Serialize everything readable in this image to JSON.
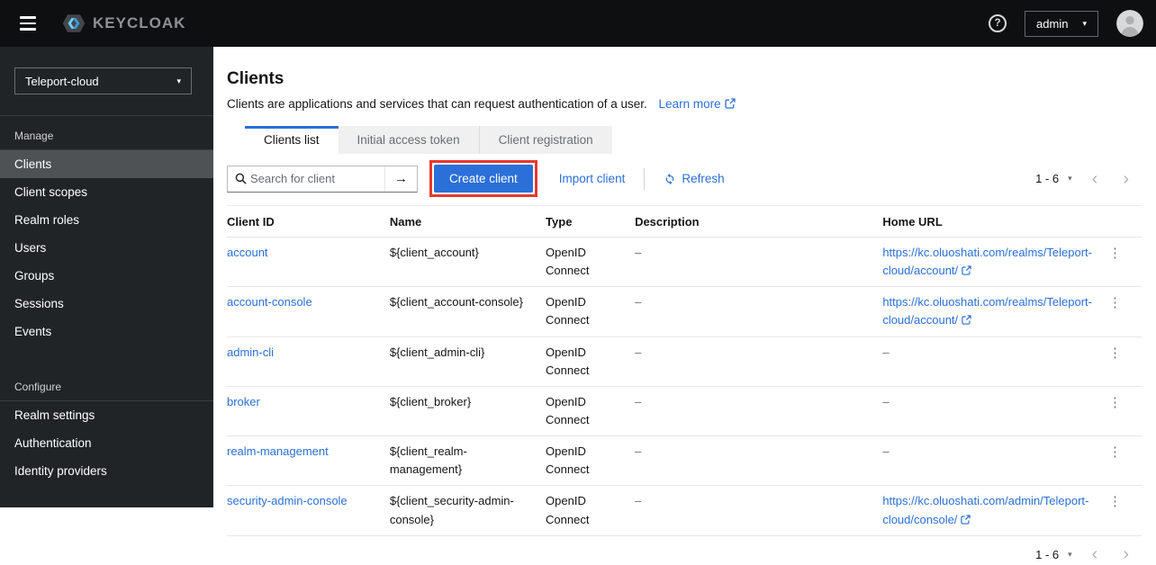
{
  "colors": {
    "accent": "#2b6fd8",
    "annotation_red": "#e8382d",
    "topbar_bg": "#0e0f11",
    "sidebar_bg": "#212427",
    "nav_active_bg": "#4f5255"
  },
  "icons": {
    "caret": "▾",
    "kebab": "⋮",
    "search_submit": "→",
    "help_glyph": "?",
    "prev": "‹",
    "next": "›"
  },
  "topbar": {
    "brand": "KEYCLOAK",
    "user": "admin"
  },
  "sidebar": {
    "realm": "Teleport-cloud",
    "active_item": "Clients",
    "sections": [
      {
        "label": "Manage",
        "items": [
          "Clients",
          "Client scopes",
          "Realm roles",
          "Users",
          "Groups",
          "Sessions",
          "Events"
        ]
      },
      {
        "label": "Configure",
        "items": [
          "Realm settings",
          "Authentication",
          "Identity providers"
        ]
      }
    ]
  },
  "page": {
    "title": "Clients",
    "description": "Clients are applications and services that can request authentication of a user.",
    "learn_more": "Learn more",
    "tabs": [
      "Clients list",
      "Initial access token",
      "Client registration"
    ],
    "active_tab": "Clients list",
    "toolbar": {
      "search_placeholder": "Search for client",
      "create": "Create client",
      "import": "Import client",
      "refresh": "Refresh"
    },
    "pagination": {
      "range": "1 - 6"
    },
    "table": {
      "columns": [
        "Client ID",
        "Name",
        "Type",
        "Description",
        "Home URL"
      ],
      "rows": [
        {
          "client_id": "account",
          "name": "${client_account}",
          "type": "OpenID Connect",
          "description": "–",
          "home_url": "https://kc.oluoshati.com/realms/Teleport-cloud/account/"
        },
        {
          "client_id": "account-console",
          "name": "${client_account-console}",
          "type": "OpenID Connect",
          "description": "–",
          "home_url": "https://kc.oluoshati.com/realms/Teleport-cloud/account/"
        },
        {
          "client_id": "admin-cli",
          "name": "${client_admin-cli}",
          "type": "OpenID Connect",
          "description": "–",
          "home_url": "–"
        },
        {
          "client_id": "broker",
          "name": "${client_broker}",
          "type": "OpenID Connect",
          "description": "–",
          "home_url": "–"
        },
        {
          "client_id": "realm-management",
          "name": "${client_realm-management}",
          "type": "OpenID Connect",
          "description": "–",
          "home_url": "–"
        },
        {
          "client_id": "security-admin-console",
          "name": "${client_security-admin-console}",
          "type": "OpenID Connect",
          "description": "–",
          "home_url": "https://kc.oluoshati.com/admin/Teleport-cloud/console/"
        }
      ]
    }
  }
}
